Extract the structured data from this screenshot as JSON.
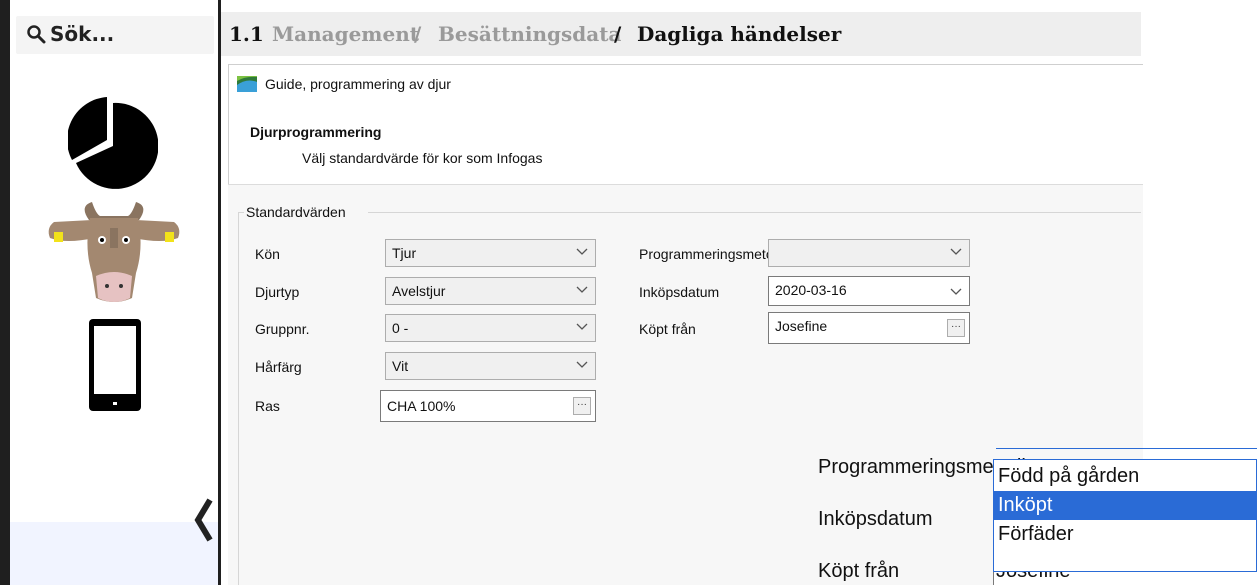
{
  "search": {
    "placeholder": "Sök..."
  },
  "breadcrumb": {
    "number": "1.1",
    "parts": [
      "Management",
      "/",
      "Besättningsdata",
      "/",
      "Dagliga händelser"
    ]
  },
  "window": {
    "title": "Guide, programmering av djur"
  },
  "header": {
    "title": "Djurprogrammering",
    "subtitle": "Välj standardvärde för kor som Infogas"
  },
  "group": {
    "title": "Standardvärden"
  },
  "left_fields": [
    {
      "label": "Kön",
      "value": "Tjur"
    },
    {
      "label": "Djurtyp",
      "value": "Avelstjur"
    },
    {
      "label": "Gruppnr.",
      "value": "0 -"
    },
    {
      "label": "Hårfärg",
      "value": "Vit"
    },
    {
      "label": "Ras",
      "value": "CHA 100%"
    }
  ],
  "right_fields": [
    {
      "label": "Programmeringsmetodbt",
      "value": ""
    },
    {
      "label": "Inköpsdatum",
      "value": "2020-03-16"
    },
    {
      "label": "Köpt från",
      "value": "Josefine"
    }
  ],
  "zoom": {
    "method_label": "Programmeringsmetodbt",
    "date_label": "Inköpsdatum",
    "bought_label": "Köpt från",
    "bought_value_partial": "Josefine",
    "options": [
      "Född på gården",
      "Inköpt",
      "Förfäder"
    ],
    "selected_index": 1
  },
  "icons": [
    "search-icon",
    "pie-chart-icon",
    "cow-icon",
    "mobile-phone-icon",
    "chevron-left-icon",
    "chevron-down-icon",
    "ellipsis-icon",
    "window-app-icon"
  ],
  "colors": {
    "selection": "#2a6bd6",
    "cow_body": "#a38870",
    "ear_tag": "#f2e21a"
  }
}
